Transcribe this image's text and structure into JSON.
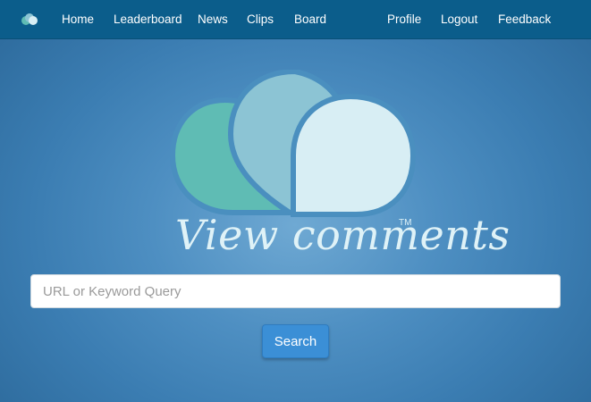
{
  "nav": {
    "brand_icon": "cloud-bubbles-icon",
    "links_left": [
      "Home",
      "Leaderboard",
      "News",
      "Clips",
      "Board"
    ],
    "links_right": [
      "Profile",
      "Logout",
      "Feedback"
    ]
  },
  "hero": {
    "logo_icon": "speech-bubbles-cloud-icon",
    "logo_text": "View comments",
    "trademark": "TM"
  },
  "search": {
    "placeholder": "URL or Keyword Query",
    "value": "",
    "button_label": "Search"
  },
  "colors": {
    "navbar": "#0b5d8b",
    "bubble_green": "#5fbcb4",
    "bubble_mid": "#8cc4d4",
    "bubble_light": "#d8eef4",
    "button": "#3b8fd6"
  }
}
